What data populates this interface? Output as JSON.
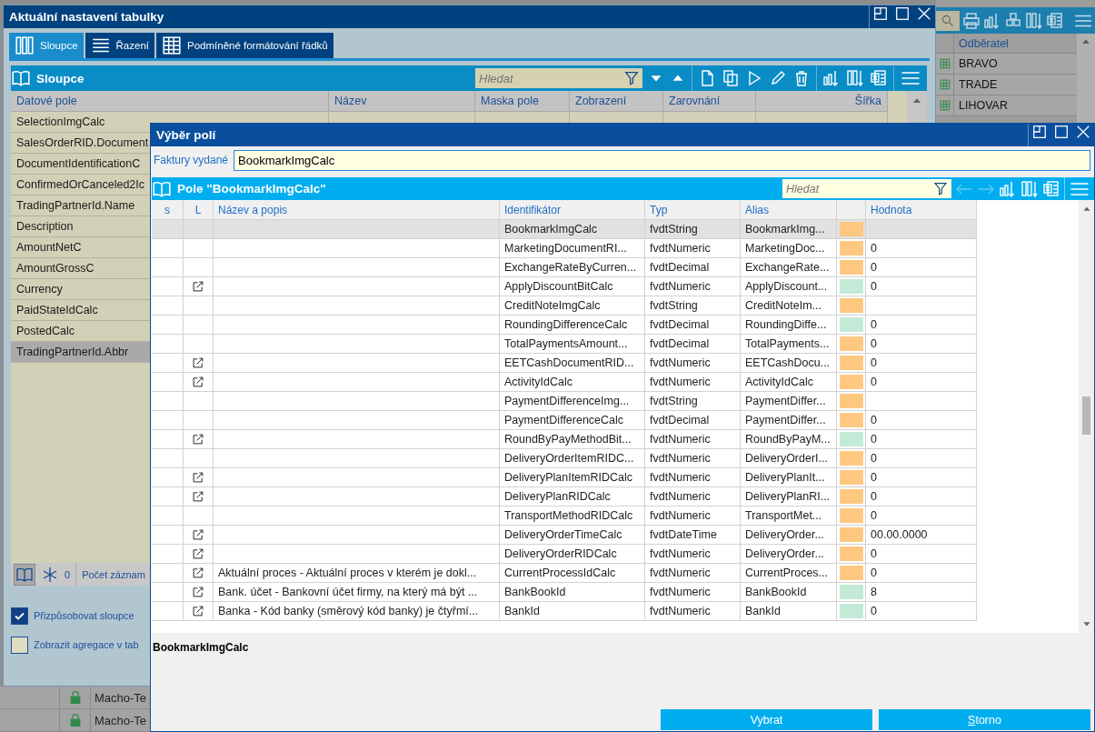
{
  "background_app": {
    "columns": [
      "Odběratel"
    ],
    "rows": [
      "BRAVO",
      "TRADE",
      "LIHOVAR"
    ],
    "lower_rows": [
      {
        "locked": true,
        "customer": "Macho-Te"
      },
      {
        "locked": true,
        "customer": "Macho-Te"
      }
    ]
  },
  "settings_window": {
    "title": "Aktuální nastavení tabulky",
    "tabs": [
      {
        "label": "Sloupce",
        "selected": true
      },
      {
        "label": "Řazení",
        "selected": false
      },
      {
        "label": "Podmíněné formátování řádků",
        "selected": false
      }
    ],
    "panel": {
      "title": "Sloupce",
      "search": {
        "placeholder": "Hledat"
      },
      "columns": [
        "Datové pole",
        "Název",
        "Maska pole",
        "Zobrazení",
        "Zarovnání",
        "Šířka"
      ],
      "rows": [
        {
          "cells": [
            "SelectionImgCalc"
          ],
          "selected": false
        },
        {
          "cells": [
            "SalesOrderRID.Document"
          ],
          "selected": false
        },
        {
          "cells": [
            "DocumentIdentificationC"
          ],
          "selected": false
        },
        {
          "cells": [
            "ConfirmedOrCanceled2Ic"
          ],
          "selected": false
        },
        {
          "cells": [
            "TradingPartnerId.Name"
          ],
          "selected": false
        },
        {
          "cells": [
            "Description"
          ],
          "selected": false
        },
        {
          "cells": [
            "AmountNetC"
          ],
          "selected": false
        },
        {
          "cells": [
            "AmountGrossC"
          ],
          "selected": false
        },
        {
          "cells": [
            "Currency"
          ],
          "selected": false
        },
        {
          "cells": [
            "PaidStateIdCalc"
          ],
          "selected": false
        },
        {
          "cells": [
            "PostedCalc"
          ],
          "selected": false
        },
        {
          "cells": [
            "TradingPartnerId.Abbr"
          ],
          "selected": true
        }
      ],
      "footer": {
        "count": "0",
        "label": "Počet záznam"
      }
    },
    "options": [
      {
        "label": "Přizpůsobovat sloupce",
        "checked": true
      },
      {
        "label": "Zobrazit agregace v tab",
        "checked": false
      }
    ]
  },
  "field_dialog": {
    "title": "Výběr polí",
    "source": {
      "label": "Faktury vydané",
      "value": "BookmarkImgCalc"
    },
    "panel": {
      "title": "Pole \"BookmarkImgCalc\"",
      "search": {
        "placeholder": "Hledat"
      },
      "columns": [
        "s",
        "L",
        "Název a popis",
        "Identifikátor",
        "Typ",
        "Alias",
        "Hodnota"
      ],
      "rows": [
        {
          "link": false,
          "id": "BookmarkImgCalc",
          "type": "fvdtString",
          "alias": "BookmarkImg...",
          "color": "#ffc880",
          "selected": true
        },
        {
          "link": false,
          "id": "MarketingDocumentRI...",
          "type": "fvdtNumeric",
          "alias": "MarketingDoc...",
          "color": "#ffc880",
          "value": "0",
          "selected": false
        },
        {
          "link": false,
          "id": "ExchangeRateByCurren...",
          "type": "fvdtDecimal",
          "alias": "ExchangeRate...",
          "color": "#ffc880",
          "value": "0",
          "selected": false
        },
        {
          "link": true,
          "id": "ApplyDiscountBitCalc",
          "type": "fvdtNumeric",
          "alias": "ApplyDiscount...",
          "color": "#c2ead6",
          "value": "0",
          "selected": false
        },
        {
          "link": false,
          "id": "CreditNoteImgCalc",
          "type": "fvdtString",
          "alias": "CreditNoteIm...",
          "color": "#ffc880",
          "selected": false
        },
        {
          "link": false,
          "id": "RoundingDifferenceCalc",
          "type": "fvdtDecimal",
          "alias": "RoundingDiffe...",
          "color": "#c2ead6",
          "value": "0",
          "selected": false
        },
        {
          "link": false,
          "id": "TotalPaymentsAmount...",
          "type": "fvdtDecimal",
          "alias": "TotalPayments...",
          "color": "#ffc880",
          "value": "0",
          "selected": false
        },
        {
          "link": true,
          "id": "EETCashDocumentRID...",
          "type": "fvdtNumeric",
          "alias": "EETCashDocu...",
          "color": "#ffc880",
          "value": "0",
          "selected": false
        },
        {
          "link": true,
          "id": "ActivityIdCalc",
          "type": "fvdtNumeric",
          "alias": "ActivityIdCalc",
          "color": "#ffc880",
          "value": "0",
          "selected": false
        },
        {
          "link": false,
          "id": "PaymentDifferenceImg...",
          "type": "fvdtString",
          "alias": "PaymentDiffer...",
          "color": "#ffc880",
          "selected": false
        },
        {
          "link": false,
          "id": "PaymentDifferenceCalc",
          "type": "fvdtDecimal",
          "alias": "PaymentDiffer...",
          "color": "#ffc880",
          "value": "0",
          "selected": false
        },
        {
          "link": true,
          "id": "RoundByPayMethodBit...",
          "type": "fvdtNumeric",
          "alias": "RoundByPayM...",
          "color": "#c2ead6",
          "value": "0",
          "selected": false
        },
        {
          "link": false,
          "id": "DeliveryOrderItemRIDC...",
          "type": "fvdtNumeric",
          "alias": "DeliveryOrderI...",
          "color": "#ffc880",
          "value": "0",
          "selected": false
        },
        {
          "link": true,
          "id": "DeliveryPlanItemRIDCalc",
          "type": "fvdtNumeric",
          "alias": "DeliveryPlanIt...",
          "color": "#ffc880",
          "value": "0",
          "selected": false
        },
        {
          "link": true,
          "id": "DeliveryPlanRIDCalc",
          "type": "fvdtNumeric",
          "alias": "DeliveryPlanRI...",
          "color": "#ffc880",
          "value": "0",
          "selected": false
        },
        {
          "link": false,
          "id": "TransportMethodRIDCalc",
          "type": "fvdtNumeric",
          "alias": "TransportMet...",
          "color": "#ffc880",
          "value": "0",
          "selected": false
        },
        {
          "link": true,
          "id": "DeliveryOrderTimeCalc",
          "type": "fvdtDateTime",
          "alias": "DeliveryOrder...",
          "color": "#ffc880",
          "value": "00.00.0000",
          "selected": false
        },
        {
          "link": true,
          "id": "DeliveryOrderRIDCalc",
          "type": "fvdtNumeric",
          "alias": "DeliveryOrder...",
          "color": "#ffc880",
          "value": "0",
          "selected": false
        },
        {
          "link": true,
          "name": "Aktuální proces - Aktuální proces v kterém je dokl...",
          "id": "CurrentProcessIdCalc",
          "type": "fvdtNumeric",
          "alias": "CurrentProces...",
          "color": "#ffc880",
          "value": "0",
          "selected": false
        },
        {
          "link": true,
          "name": "Bank. účet - Bankovní účet firmy, na který má být ...",
          "id": "BankBookId",
          "type": "fvdtNumeric",
          "alias": "BankBookId",
          "color": "#c2ead6",
          "value": "8",
          "selected": false
        },
        {
          "link": true,
          "name": "Banka - Kód banky (směrový kód banky) je čtyřmí...",
          "id": "BankId",
          "type": "fvdtNumeric",
          "alias": "BankId",
          "color": "#c2ead6",
          "value": "0",
          "selected": false
        }
      ]
    },
    "selection": "BookmarkImgCalc",
    "buttons": [
      "Vybrat",
      "Storno"
    ]
  }
}
